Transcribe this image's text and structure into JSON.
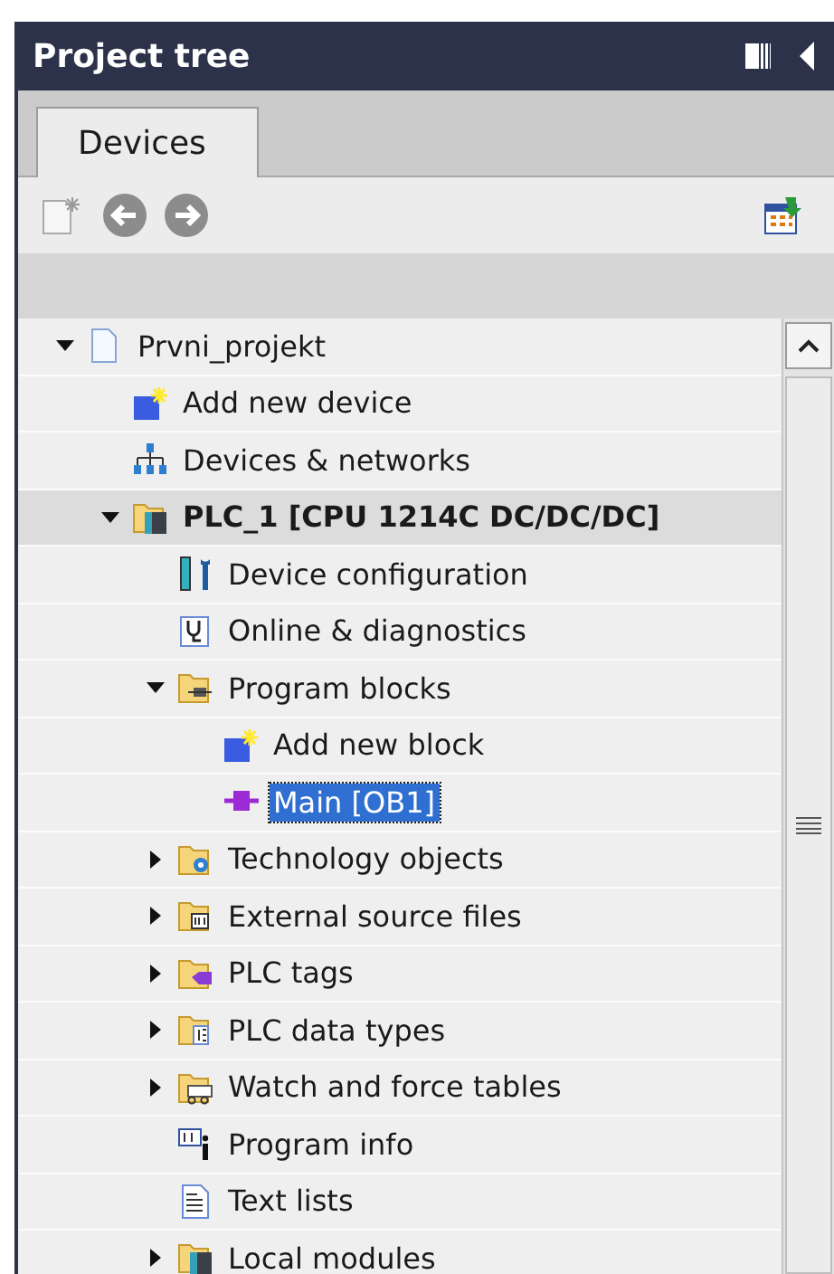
{
  "panel": {
    "title": "Project tree"
  },
  "tabs": [
    {
      "label": "Devices",
      "selected": true
    }
  ],
  "tree": [
    {
      "label": "Prvni_projekt",
      "kind": "project",
      "expanded": true,
      "selected": false,
      "children": [
        {
          "label": "Add new device",
          "kind": "add",
          "selected": false
        },
        {
          "label": "Devices & networks",
          "kind": "network",
          "selected": false
        },
        {
          "label": "PLC_1 [CPU 1214C DC/DC/DC]",
          "kind": "plc",
          "expanded": true,
          "selected": false,
          "emphasized": true,
          "children": [
            {
              "label": "Device configuration",
              "kind": "config",
              "selected": false
            },
            {
              "label": "Online & diagnostics",
              "kind": "online",
              "selected": false
            },
            {
              "label": "Program blocks",
              "kind": "folder-blocks",
              "expanded": true,
              "selected": false,
              "children": [
                {
                  "label": "Add new block",
                  "kind": "add",
                  "selected": false
                },
                {
                  "label": "Main [OB1]",
                  "kind": "block",
                  "selected": true
                }
              ]
            },
            {
              "label": "Technology objects",
              "kind": "folder-tech",
              "expanded": false,
              "selected": false
            },
            {
              "label": "External source files",
              "kind": "folder-source",
              "expanded": false,
              "selected": false
            },
            {
              "label": "PLC tags",
              "kind": "folder-tags",
              "expanded": false,
              "selected": false
            },
            {
              "label": "PLC data types",
              "kind": "folder-types",
              "expanded": false,
              "selected": false
            },
            {
              "label": "Watch and force tables",
              "kind": "folder-watch",
              "expanded": false,
              "selected": false
            },
            {
              "label": "Program info",
              "kind": "info",
              "selected": false
            },
            {
              "label": "Text lists",
              "kind": "textlist",
              "selected": false
            },
            {
              "label": "Local modules",
              "kind": "folder-modules",
              "expanded": false,
              "selected": false
            }
          ]
        }
      ]
    }
  ]
}
